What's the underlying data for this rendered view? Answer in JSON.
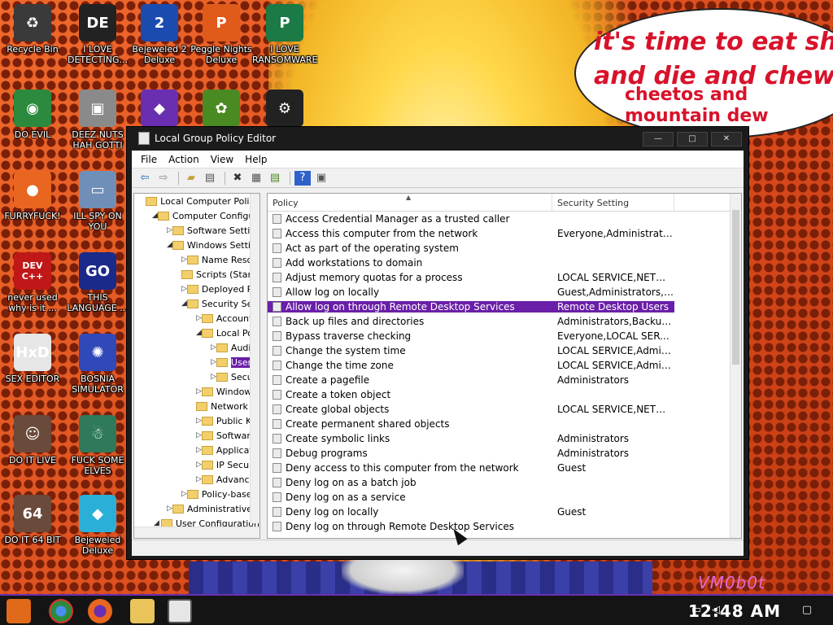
{
  "wallpaper": {
    "bubble_lines": [
      "it's time to eat shit",
      "and die and chew",
      "cheetos and",
      "mountain dew"
    ],
    "watermark": "VM0b0t"
  },
  "desktop_icons": [
    {
      "label": "Recycle Bin",
      "icon": "recycle-bin-icon",
      "glyph": "♻",
      "color": "#3a3a3a"
    },
    {
      "label": "I LOVE DETECTING...",
      "icon": "detect-it-easy-icon",
      "glyph": "DE",
      "color": "#222222"
    },
    {
      "label": "Bejeweled 2 Deluxe",
      "icon": "bejeweled-2-icon",
      "glyph": "2",
      "color": "#1c4bb0"
    },
    {
      "label": "Peggle Nights Deluxe",
      "icon": "peggle-icon",
      "glyph": "P",
      "color": "#e05a1a"
    },
    {
      "label": "I LOVE RANSOMWARE",
      "icon": "publisher-icon",
      "glyph": "P",
      "color": "#1b7a45"
    },
    {
      "label": "DO EVIL",
      "icon": "chrome-icon",
      "glyph": "◉",
      "color": "#2b8a3e"
    },
    {
      "label": "DEEZ NUTS HAH GOTTI",
      "icon": "copies-icon",
      "glyph": "▣",
      "color": "#8a8a8a"
    },
    {
      "label": "",
      "icon": "gem-icon",
      "glyph": "◆",
      "color": "#6a2fb0"
    },
    {
      "label": "",
      "icon": "plant-icon",
      "glyph": "✿",
      "color": "#4a8a22"
    },
    {
      "label": "",
      "icon": "gear-skull-icon",
      "glyph": "⚙",
      "color": "#222222"
    },
    {
      "label": "FURRYFUCK!",
      "icon": "firefox-icon",
      "glyph": "●",
      "color": "#e8661f"
    },
    {
      "label": "ILL SPY ON YOU",
      "icon": "remote-desktop-icon",
      "glyph": "▭",
      "color": "#6f8fb8"
    },
    {
      "label": "never used why is it ...",
      "icon": "devcpp-icon",
      "glyph": "DEV C++",
      "color": "#c01818"
    },
    {
      "label": "THIS LANGUAGE ...",
      "icon": "goland-icon",
      "glyph": "GO",
      "color": "#1a2a8a"
    },
    {
      "label": "SEX EDITOR",
      "icon": "hxd-icon",
      "glyph": "HxD",
      "color": "#e6e6e6"
    },
    {
      "label": "BOSNIA SIMULATOR",
      "icon": "virus-icon",
      "glyph": "✺",
      "color": "#3048b8"
    },
    {
      "label": "DO IT LIVE",
      "icon": "portrait-icon",
      "glyph": "☺",
      "color": "#6a4a3a"
    },
    {
      "label": "FUCK SOME ELVES",
      "icon": "santa-icon",
      "glyph": "☃",
      "color": "#2e7a5a"
    },
    {
      "label": "DO IT 64 BIT",
      "icon": "portrait-64-icon",
      "glyph": "64",
      "color": "#6a4a3a"
    },
    {
      "label": "Bejeweled Deluxe",
      "icon": "diamond-icon",
      "glyph": "◆",
      "color": "#2ab0d8"
    }
  ],
  "window": {
    "title": "Local Group Policy Editor",
    "buttons": {
      "minimize": "—",
      "maximize": "□",
      "close": "✕"
    },
    "menu": [
      "File",
      "Action",
      "View",
      "Help"
    ],
    "toolbar_icons": [
      "back-icon",
      "forward-icon",
      "up-folder-icon",
      "show-hide-tree-icon",
      "delete-icon",
      "properties-icon",
      "export-icon",
      "help-icon",
      "console-icon"
    ]
  },
  "tree": [
    {
      "label": "Local Computer Policy",
      "indent": 0,
      "arrow": ""
    },
    {
      "label": "Computer Configuration",
      "indent": 1,
      "arrow": "◢"
    },
    {
      "label": "Software Settings",
      "indent": 2,
      "arrow": "▷"
    },
    {
      "label": "Windows Settings",
      "indent": 2,
      "arrow": "◢"
    },
    {
      "label": "Name Resolution Policy",
      "indent": 3,
      "arrow": "▷"
    },
    {
      "label": "Scripts (Startup/Shutdown)",
      "indent": 3,
      "arrow": ""
    },
    {
      "label": "Deployed Printers",
      "indent": 3,
      "arrow": "▷"
    },
    {
      "label": "Security Settings",
      "indent": 3,
      "arrow": "◢"
    },
    {
      "label": "Account Policies",
      "indent": 4,
      "arrow": "▷"
    },
    {
      "label": "Local Policies",
      "indent": 4,
      "arrow": "◢"
    },
    {
      "label": "Audit Policy",
      "indent": 5,
      "arrow": "▷"
    },
    {
      "label": "User Rights Assignment",
      "indent": 5,
      "arrow": "▷",
      "selected": true
    },
    {
      "label": "Security Options",
      "indent": 5,
      "arrow": "▷"
    },
    {
      "label": "Windows Defender Firewall",
      "indent": 4,
      "arrow": "▷"
    },
    {
      "label": "Network List Manager Policies",
      "indent": 4,
      "arrow": ""
    },
    {
      "label": "Public Key Policies",
      "indent": 4,
      "arrow": "▷"
    },
    {
      "label": "Software Restriction Policies",
      "indent": 4,
      "arrow": "▷"
    },
    {
      "label": "Application Control Policies",
      "indent": 4,
      "arrow": "▷"
    },
    {
      "label": "IP Security Policies",
      "indent": 4,
      "arrow": "▷"
    },
    {
      "label": "Advanced Audit Policy",
      "indent": 4,
      "arrow": "▷"
    },
    {
      "label": "Policy-based QoS",
      "indent": 3,
      "arrow": "▷"
    },
    {
      "label": "Administrative Templates",
      "indent": 2,
      "arrow": "▷"
    },
    {
      "label": "User Configuration",
      "indent": 1,
      "arrow": "◢"
    }
  ],
  "list": {
    "columns": [
      "Policy",
      "Security Setting"
    ],
    "rows": [
      {
        "policy": "Access Credential Manager as a trusted caller",
        "setting": ""
      },
      {
        "policy": "Access this computer from the network",
        "setting": "Everyone,Administrators,..."
      },
      {
        "policy": "Act as part of the operating system",
        "setting": ""
      },
      {
        "policy": "Add workstations to domain",
        "setting": ""
      },
      {
        "policy": "Adjust memory quotas for a process",
        "setting": "LOCAL SERVICE,NETWORK..."
      },
      {
        "policy": "Allow log on locally",
        "setting": "Guest,Administrators,User..."
      },
      {
        "policy": "Allow log on through Remote Desktop Services",
        "setting": "Remote Desktop Users",
        "selected": true
      },
      {
        "policy": "Back up files and directories",
        "setting": "Administrators,Backup Op..."
      },
      {
        "policy": "Bypass traverse checking",
        "setting": "Everyone,LOCAL SERVICE..."
      },
      {
        "policy": "Change the system time",
        "setting": "LOCAL SERVICE,Administr..."
      },
      {
        "policy": "Change the time zone",
        "setting": "LOCAL SERVICE,Administr..."
      },
      {
        "policy": "Create a pagefile",
        "setting": "Administrators"
      },
      {
        "policy": "Create a token object",
        "setting": ""
      },
      {
        "policy": "Create global objects",
        "setting": "LOCAL SERVICE,NETWORK..."
      },
      {
        "policy": "Create permanent shared objects",
        "setting": ""
      },
      {
        "policy": "Create symbolic links",
        "setting": "Administrators"
      },
      {
        "policy": "Debug programs",
        "setting": "Administrators"
      },
      {
        "policy": "Deny access to this computer from the network",
        "setting": "Guest"
      },
      {
        "policy": "Deny log on as a batch job",
        "setting": ""
      },
      {
        "policy": "Deny log on as a service",
        "setting": ""
      },
      {
        "policy": "Deny log on locally",
        "setting": "Guest"
      },
      {
        "policy": "Deny log on through Remote Desktop Services",
        "setting": ""
      }
    ]
  },
  "taskbar": {
    "items": [
      "start-icon",
      "chrome-icon",
      "firefox-icon",
      "file-explorer-icon",
      "group-policy-icon"
    ],
    "clock": "12:48 AM",
    "tray": [
      "network-icon",
      "volume-icon",
      "notification-icon"
    ]
  }
}
